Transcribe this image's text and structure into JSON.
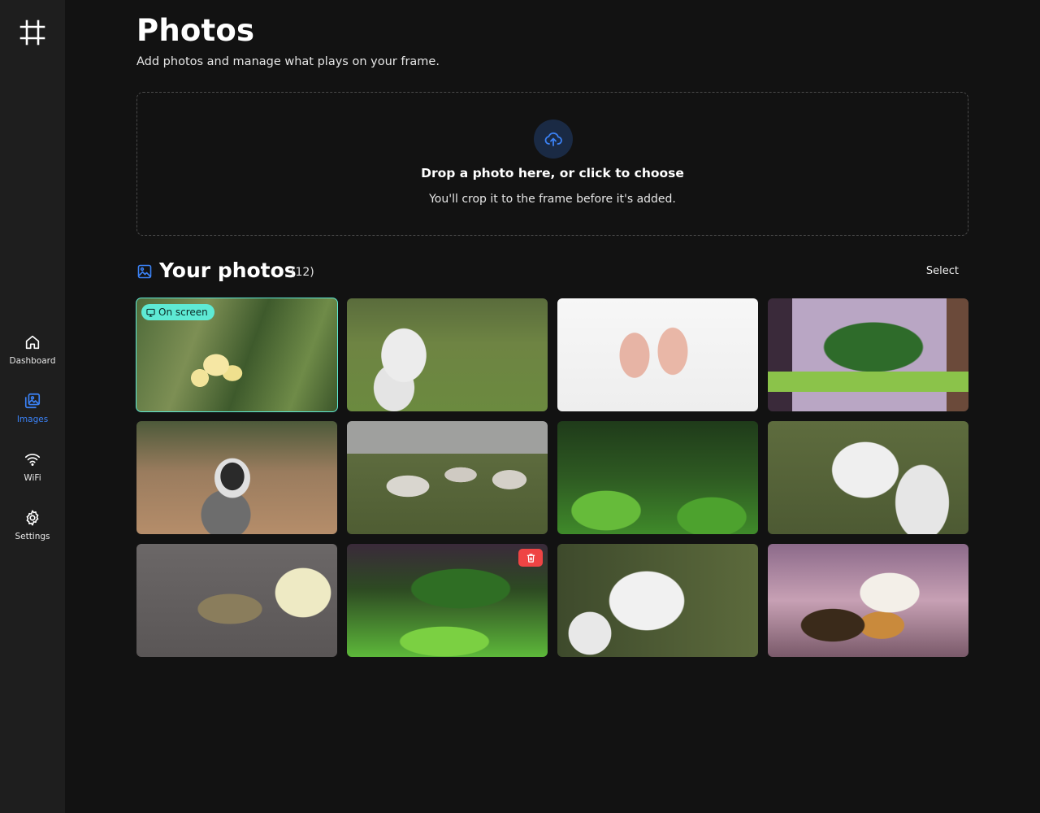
{
  "sidebar": {
    "logo_icon": "frame-crop-icon",
    "items": [
      {
        "label": "Dashboard",
        "icon": "home-icon",
        "active": false
      },
      {
        "label": "Images",
        "icon": "images-icon",
        "active": true
      },
      {
        "label": "WiFi",
        "icon": "wifi-icon",
        "active": false
      },
      {
        "label": "Settings",
        "icon": "gear-icon",
        "active": false
      }
    ]
  },
  "page": {
    "title": "Photos",
    "subtitle": "Add photos and manage what plays on your frame."
  },
  "dropzone": {
    "icon": "cloud-upload-icon",
    "title": "Drop a photo here, or click to choose",
    "subtitle": "You'll crop it to the frame before it's added."
  },
  "photos_section": {
    "icon": "image-icon",
    "title": "Your photos",
    "count": "(12)",
    "select_label": "Select",
    "on_screen_label": "On screen",
    "delete_icon": "trash-icon"
  },
  "colors": {
    "accent": "#3b82f6",
    "on_screen": "#5eead4",
    "delete": "#ef4444",
    "background": "#121212",
    "sidebar": "#1e1e1e"
  }
}
